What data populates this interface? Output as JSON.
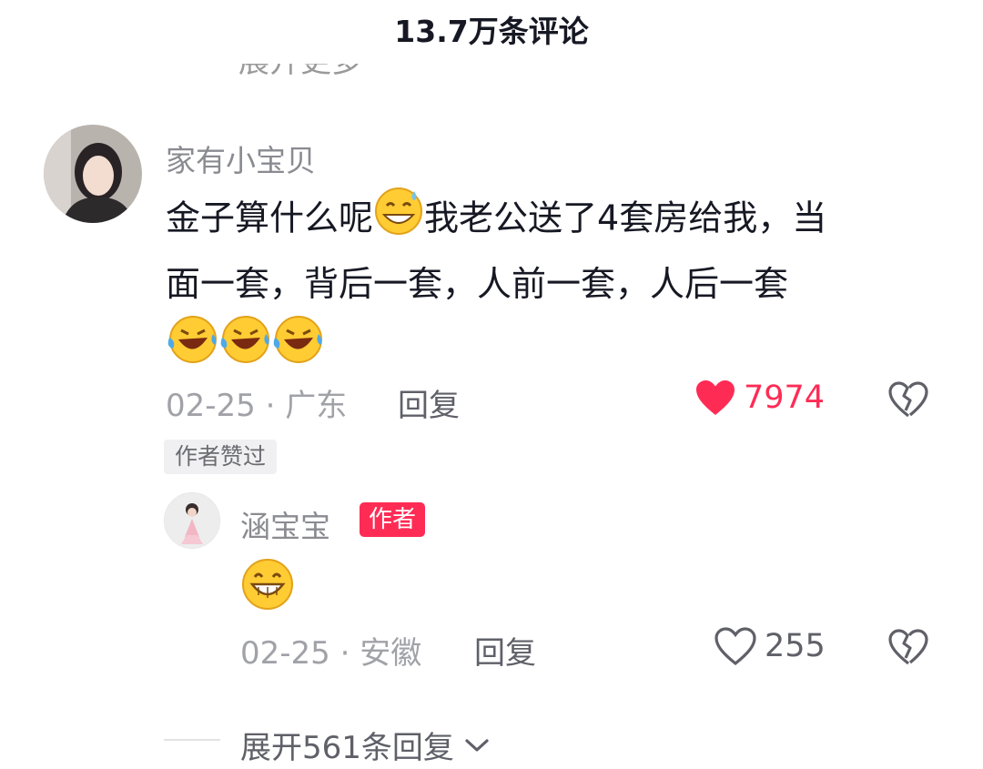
{
  "header": {
    "title": "13.7万条评论"
  },
  "prev_expand": {
    "label": "展开更多"
  },
  "comment": {
    "username": "家有小宝贝",
    "text_line1": "金子算什么呢",
    "text_line1b": "我老公送了4套房给我，当",
    "text_line2": "面一套，背后一套，人前一套，人后一套",
    "date": "02-25",
    "location": "广东",
    "date_loc": "02-25 · 广东",
    "reply_label": "回复",
    "likes": "7974",
    "liked": true,
    "author_liked_tag": "作者赞过"
  },
  "reply": {
    "username": "涵宝宝",
    "author_badge": "作者",
    "date_loc": "02-25 · 安徽",
    "reply_label": "回复",
    "likes": "255",
    "liked": false
  },
  "expand": {
    "label": "展开561条回复"
  },
  "colors": {
    "accent": "#fe2c55",
    "text": "#161823",
    "muted": "#a1a2a8"
  },
  "icons": [
    "heart-filled-icon",
    "heart-outline-icon",
    "broken-heart-icon",
    "chevron-down-icon",
    "sweat-smile-emoji",
    "laughing-crying-emoji",
    "grin-emoji"
  ]
}
